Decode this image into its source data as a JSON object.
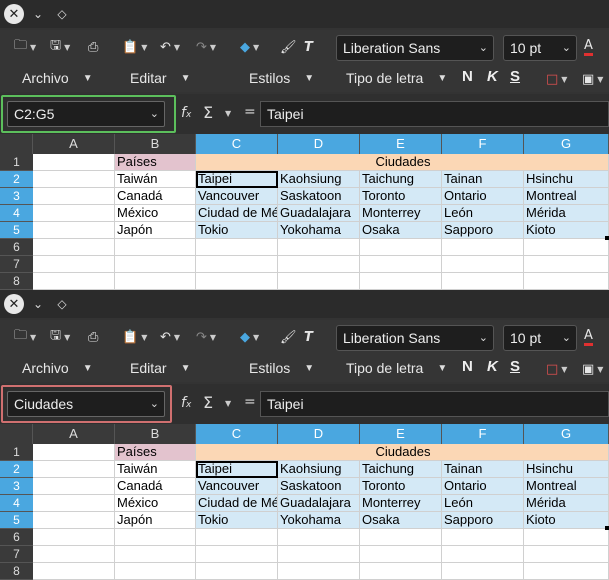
{
  "app": {
    "font_name": "Liberation Sans",
    "font_size": "10 pt",
    "menus": [
      "Archivo",
      "Editar",
      "Estilos",
      "Tipo de letra"
    ],
    "format_labels": [
      "N",
      "K",
      "S"
    ]
  },
  "panels": [
    {
      "namebox": "C2:G5",
      "formula": "Taipei",
      "highlight": "green"
    },
    {
      "namebox": "Ciudades",
      "formula": "Taipei",
      "highlight": "red"
    }
  ],
  "sheet": {
    "columns": [
      "A",
      "B",
      "C",
      "D",
      "E",
      "F",
      "G"
    ],
    "rows": [
      "1",
      "2",
      "3",
      "4",
      "5",
      "6",
      "7",
      "8"
    ],
    "header_b": "Países",
    "header_c": "Ciudades",
    "countries": [
      "Taiwán",
      "Canadá",
      "México",
      "Japón"
    ],
    "cities": [
      [
        "Taipei",
        "Kaohsiung",
        "Taichung",
        "Tainan",
        "Hsinchu"
      ],
      [
        "Vancouver",
        "Saskatoon",
        "Toronto",
        "Ontario",
        "Montreal"
      ],
      [
        "Ciudad de México",
        "Guadalajara",
        "Monterrey",
        "León",
        "Mérida"
      ],
      [
        "Tokio",
        "Yokohama",
        "Osaka",
        "Sapporo",
        "Kioto"
      ]
    ]
  },
  "colors": {
    "selection": "#d4e9f6",
    "header_selected": "#4aa7e0",
    "pink": "#e3c3ce",
    "peach": "#fbd7b5",
    "green_highlight": "#5cbf5c",
    "red_highlight": "#d07070"
  }
}
